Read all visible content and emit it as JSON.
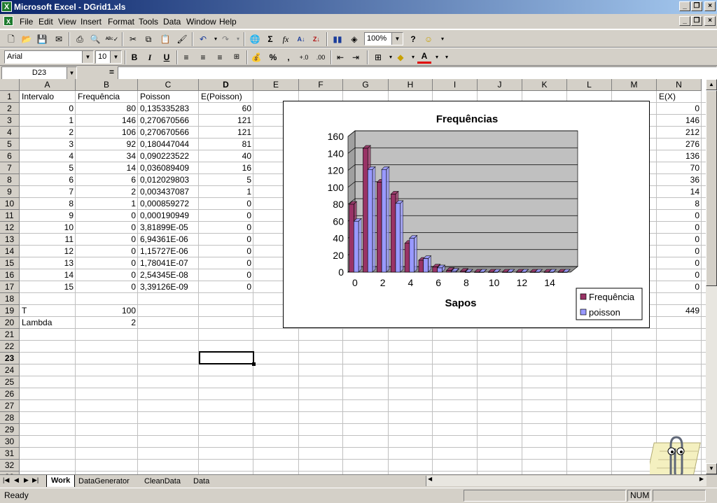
{
  "window": {
    "title": "Microsoft Excel - DGrid1.xls",
    "app_icon": "X"
  },
  "menu": [
    {
      "label": "File"
    },
    {
      "label": "Edit"
    },
    {
      "label": "View"
    },
    {
      "label": "Insert"
    },
    {
      "label": "Format"
    },
    {
      "label": "Tools"
    },
    {
      "label": "Data"
    },
    {
      "label": "Window"
    },
    {
      "label": "Help"
    }
  ],
  "toolbar": {
    "zoom": "100%",
    "font": "Arial",
    "size": "10"
  },
  "formula_bar": {
    "name_box": "D23",
    "equals": "=",
    "formula": ""
  },
  "columns": [
    "A",
    "B",
    "C",
    "D",
    "E",
    "F",
    "G",
    "H",
    "I",
    "J",
    "K",
    "L",
    "M",
    "N"
  ],
  "rows": [
    "1",
    "2",
    "3",
    "4",
    "5",
    "6",
    "7",
    "8",
    "9",
    "10",
    "11",
    "12",
    "13",
    "14",
    "15",
    "16",
    "17",
    "18",
    "19",
    "20",
    "21",
    "22",
    "23",
    "24",
    "25",
    "26",
    "27",
    "28",
    "29",
    "30",
    "31",
    "32",
    "33"
  ],
  "sheet": {
    "headers": {
      "A": "Intervalo",
      "B": "Frequência",
      "C": "Poisson",
      "D": "E(Poisson)",
      "N": "E(X)"
    },
    "data": [
      {
        "a": "0",
        "b": "80",
        "c": "0,135335283",
        "d": "60",
        "n": "0"
      },
      {
        "a": "1",
        "b": "146",
        "c": "0,270670566",
        "d": "121",
        "n": "146"
      },
      {
        "a": "2",
        "b": "106",
        "c": "0,270670566",
        "d": "121",
        "n": "212"
      },
      {
        "a": "3",
        "b": "92",
        "c": "0,180447044",
        "d": "81",
        "n": "276"
      },
      {
        "a": "4",
        "b": "34",
        "c": "0,090223522",
        "d": "40",
        "n": "136"
      },
      {
        "a": "5",
        "b": "14",
        "c": "0,036089409",
        "d": "16",
        "n": "70"
      },
      {
        "a": "6",
        "b": "6",
        "c": "0,012029803",
        "d": "5",
        "n": "36"
      },
      {
        "a": "7",
        "b": "2",
        "c": "0,003437087",
        "d": "1",
        "n": "14"
      },
      {
        "a": "8",
        "b": "1",
        "c": "0,000859272",
        "d": "0",
        "n": "8"
      },
      {
        "a": "9",
        "b": "0",
        "c": "0,000190949",
        "d": "0",
        "n": "0"
      },
      {
        "a": "10",
        "b": "0",
        "c": "3,81899E-05",
        "d": "0",
        "n": "0"
      },
      {
        "a": "11",
        "b": "0",
        "c": "6,94361E-06",
        "d": "0",
        "n": "0"
      },
      {
        "a": "12",
        "b": "0",
        "c": "1,15727E-06",
        "d": "0",
        "n": "0"
      },
      {
        "a": "13",
        "b": "0",
        "c": "1,78041E-07",
        "d": "0",
        "n": "0"
      },
      {
        "a": "14",
        "b": "0",
        "c": "2,54345E-08",
        "d": "0",
        "n": "0"
      },
      {
        "a": "15",
        "b": "0",
        "c": "3,39126E-09",
        "d": "0",
        "n": "0"
      }
    ],
    "t_label": "T",
    "t_value": "100",
    "n_total": "449",
    "lambda_label": "Lambda",
    "lambda_value": "2"
  },
  "chart_data": {
    "type": "bar",
    "title": "Frequências",
    "xlabel": "Sapos",
    "ylabel": "",
    "categories": [
      "0",
      "1",
      "2",
      "3",
      "4",
      "5",
      "6",
      "7",
      "8",
      "9",
      "10",
      "11",
      "12",
      "13",
      "14",
      "15"
    ],
    "x_tick_labels": [
      "0",
      "2",
      "4",
      "6",
      "8",
      "10",
      "12",
      "14"
    ],
    "y_tick_labels": [
      "0",
      "20",
      "40",
      "60",
      "80",
      "100",
      "120",
      "140",
      "160"
    ],
    "ylim": [
      0,
      160
    ],
    "series": [
      {
        "name": "Frequência",
        "color": "#993366",
        "values": [
          80,
          146,
          106,
          92,
          34,
          14,
          6,
          2,
          1,
          0,
          0,
          0,
          0,
          0,
          0,
          0
        ]
      },
      {
        "name": "poisson",
        "color": "#9999ff",
        "values": [
          60,
          121,
          121,
          81,
          40,
          16,
          5,
          1,
          0,
          0,
          0,
          0,
          0,
          0,
          0,
          0
        ]
      }
    ],
    "legend": "bottom-right",
    "grid": true
  },
  "sheet_tabs": [
    {
      "label": "Work",
      "active": true
    },
    {
      "label": "DataGenerator"
    },
    {
      "label": "CleanData"
    },
    {
      "label": "Data"
    }
  ],
  "status": {
    "ready": "Ready",
    "num": "NUM"
  }
}
